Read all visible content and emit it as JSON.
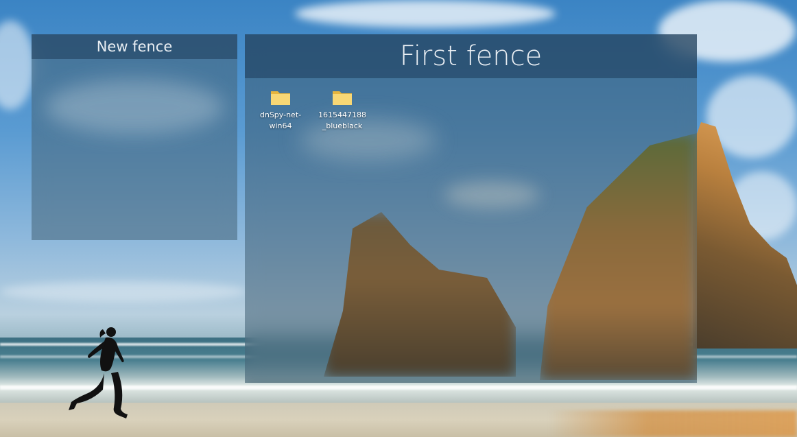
{
  "fences": [
    {
      "title": "New fence",
      "items": []
    },
    {
      "title": "First fence",
      "items": [
        {
          "label_line1": "dnSpy-net-",
          "label_line2": "win64",
          "icon": "folder-icon"
        },
        {
          "label_line1": "1615447188",
          "label_line2": "_blueblack",
          "icon": "folder-icon"
        }
      ]
    }
  ],
  "colors": {
    "fence_bg": "#3c5a6e",
    "fence_title_bg": "#1e3c5a",
    "fence_title_text": "#e9eef3",
    "folder_yellow": "#f8d775"
  }
}
